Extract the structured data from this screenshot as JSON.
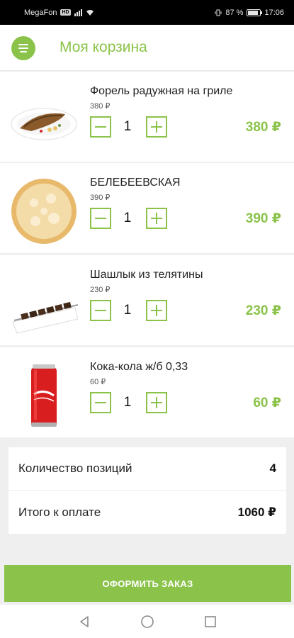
{
  "status_bar": {
    "carrier": "MegaFon",
    "network_badge": "HD",
    "battery": "87 %",
    "time": "17:06",
    "battery_level": 0.87
  },
  "header": {
    "title": "Моя корзина",
    "menu_icon": "hamburger-icon"
  },
  "colors": {
    "accent": "#8bc34a",
    "background": "#efefef"
  },
  "cart": {
    "items": [
      {
        "name": "Форель радужная на гриле",
        "unit_price": "380 ₽",
        "quantity": "1",
        "total": "380 ₽",
        "image": "grilled-trout-image"
      },
      {
        "name": "БЕЛЕБЕЕВСКАЯ",
        "unit_price": "390 ₽",
        "quantity": "1",
        "total": "390 ₽",
        "image": "pizza-image"
      },
      {
        "name": "Шашлык из телятины",
        "unit_price": "230 ₽",
        "quantity": "1",
        "total": "230 ₽",
        "image": "veal-kebab-image"
      },
      {
        "name": "Кока-кола ж/б 0,33",
        "unit_price": "60 ₽",
        "quantity": "1",
        "total": "60 ₽",
        "image": "coca-cola-can-image"
      }
    ]
  },
  "summary": {
    "count_label": "Количество позиций",
    "count_value": "4",
    "total_label": "Итого к оплате",
    "total_value": "1060 ₽"
  },
  "checkout": {
    "label": "ОФОРМИТЬ ЗАКАЗ"
  },
  "nav": {
    "icons": [
      "back-icon",
      "home-icon",
      "recents-icon"
    ]
  }
}
